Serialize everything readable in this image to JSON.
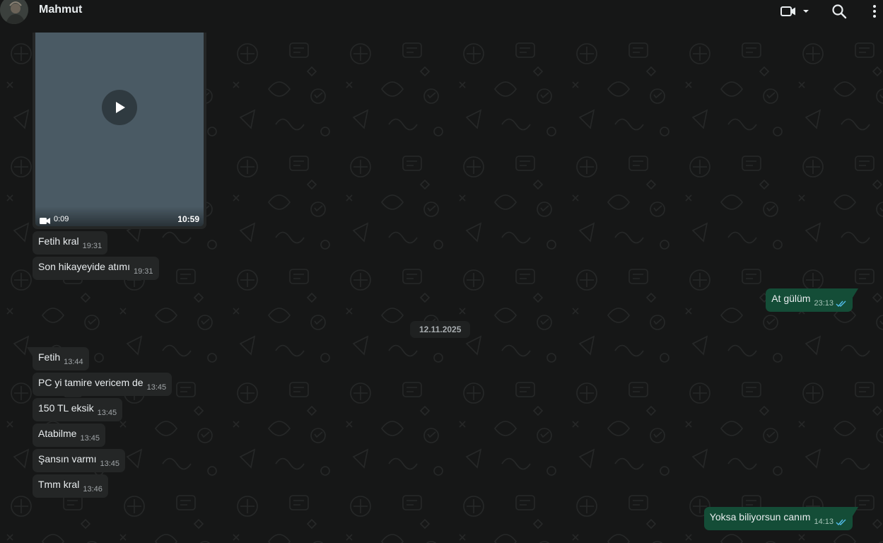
{
  "header": {
    "contact_name": "Mahmut",
    "icons": [
      "avatar",
      "video-call-icon",
      "chevron-down-icon",
      "search-icon",
      "more-vert-icon"
    ]
  },
  "video_message": {
    "duration": "0:09",
    "time": "10:59"
  },
  "date_chip": "12.11.2025",
  "messages_incoming_1": [
    {
      "text": "Fetih kral",
      "time": "19:31"
    },
    {
      "text": "Son hikayeyide atımı",
      "time": "19:31"
    }
  ],
  "message_outgoing_1": {
    "text": "At gülüm",
    "time": "23:13"
  },
  "messages_incoming_2": [
    {
      "text": "Fetih",
      "time": "13:44"
    },
    {
      "text": "PC yi tamire vericem de",
      "time": "13:45"
    },
    {
      "text": "150 TL eksik",
      "time": "13:45"
    },
    {
      "text": "Atabilme",
      "time": "13:45"
    },
    {
      "text": "Şansın varmı",
      "time": "13:45"
    },
    {
      "text": "Tmm kral",
      "time": "13:46"
    }
  ],
  "message_outgoing_2": {
    "text": "Yoksa biliyorsun canım",
    "time": "14:13"
  },
  "colors": {
    "background": "#161717",
    "incoming_bubble": "#242626",
    "outgoing_bubble": "#144d37",
    "read_ticks": "#53bdeb"
  }
}
